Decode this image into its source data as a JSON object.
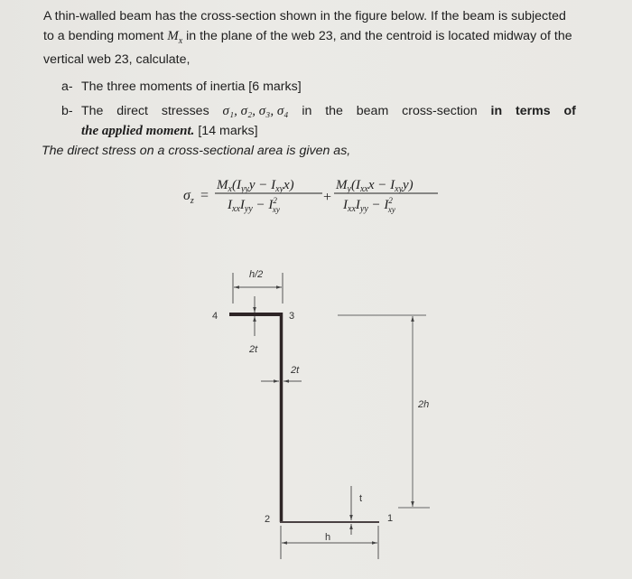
{
  "problem": {
    "intro": {
      "part1": "A thin-walled beam has the cross-section shown in the figure below.  If the beam is subjected to a bending moment ",
      "moment_symbol": "M",
      "moment_subscript": "x",
      "part2": " in the plane of the web 23, and the centroid is located midway of the vertical web 23, calculate,"
    },
    "tasks": [
      {
        "marker": "a-",
        "text": "The three moments of inertia [6 marks]"
      },
      {
        "marker": "b-",
        "words": [
          "The",
          "direct",
          "stresses",
          "σ₁, σ₂, σ₃, σ₄",
          "in",
          "the",
          "beam",
          "cross-section",
          "in",
          "terms",
          "of"
        ],
        "emphasis": "the applied moment.",
        "suffix": " [14 marks]"
      }
    ],
    "formula_intro": "The direct stress on a cross-sectional area is given as,",
    "formula": {
      "lhs": "σ",
      "lhs_sub": "z",
      "equals": "=",
      "term1_num": "Mx(Iyy y − Ixy x)",
      "term1_den": "Ixx Iyy − I²xy",
      "plus": "+",
      "term2_num": "My(Ixx x − Ixy y)",
      "term2_den": "Ixx Iyy − I²xy"
    }
  },
  "figure": {
    "node_labels": {
      "n1": "1",
      "n2": "2",
      "n3": "3",
      "n4": "4"
    },
    "dimensions": {
      "top_flange_width": "h/2",
      "top_flange_thickness": "2t",
      "web_thickness": "2t",
      "web_height": "2h",
      "bottom_flange_width": "h",
      "bottom_flange_thickness": "t"
    },
    "colors": {
      "section": "#2e2526",
      "dim": "#555555"
    }
  }
}
